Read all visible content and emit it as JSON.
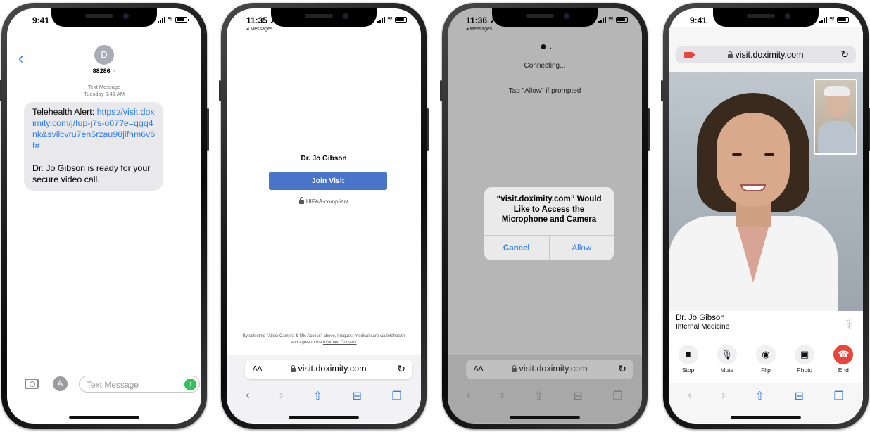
{
  "phone1": {
    "time": "9:41",
    "avatar_letter": "D",
    "contact": "88286",
    "contact_chevron": ">",
    "meta_type": "Text Message",
    "meta_time": "Tuesday 9:41 AM",
    "bubble_prefix": "Telehealth Alert: ",
    "bubble_link": "https://visit.doximity.com/j/fup-j7s-o07?e=qgq4nk&svilcvru7en5rzau98jifhm6v6f#",
    "bubble_body": "Dr. Jo Gibson is ready for your secure video call.",
    "input_placeholder": "Text Message",
    "send_glyph": "↑"
  },
  "phone2": {
    "time": "11:35",
    "back_label": "◂ Messages",
    "doctor": "Dr. Jo Gibson",
    "join_button": "Join Visit",
    "hipaa": "HIPAA-compliant",
    "consent_pre": "By selecting \"Allow Camera & Mic Access\" above, I request medical care via telehealth and agree to the ",
    "consent_link": "Informed Consent",
    "aa": "AA",
    "url": "visit.doximity.com",
    "reload": "↻"
  },
  "phone3": {
    "time": "11:36",
    "back_label": "◂ Messages",
    "connecting": "Connecting...",
    "tap_allow": "Tap \"Allow\" if prompted",
    "alert_title": "“visit.doximity.com” Would Like to Access the Microphone and Camera",
    "cancel": "Cancel",
    "allow": "Allow",
    "aa": "AA",
    "url": "visit.doximity.com",
    "reload": "↻"
  },
  "phone4": {
    "time": "9:41",
    "url": "visit.doximity.com",
    "reload": "↻",
    "doctor_name": "Dr. Jo Gibson",
    "specialty": "Internal Medicine",
    "caduceus": "⚕",
    "tools": [
      {
        "label": "Stop",
        "icon": "■"
      },
      {
        "label": "Mute",
        "icon": "🎙"
      },
      {
        "label": "Flip",
        "icon": "◉"
      },
      {
        "label": "Photo",
        "icon": "▣"
      },
      {
        "label": "End",
        "icon": "☎"
      }
    ]
  },
  "safari_toolbar": {
    "back": "‹",
    "forward": "›",
    "share": "⇧",
    "bookmarks": "⊟",
    "tabs": "❐"
  }
}
